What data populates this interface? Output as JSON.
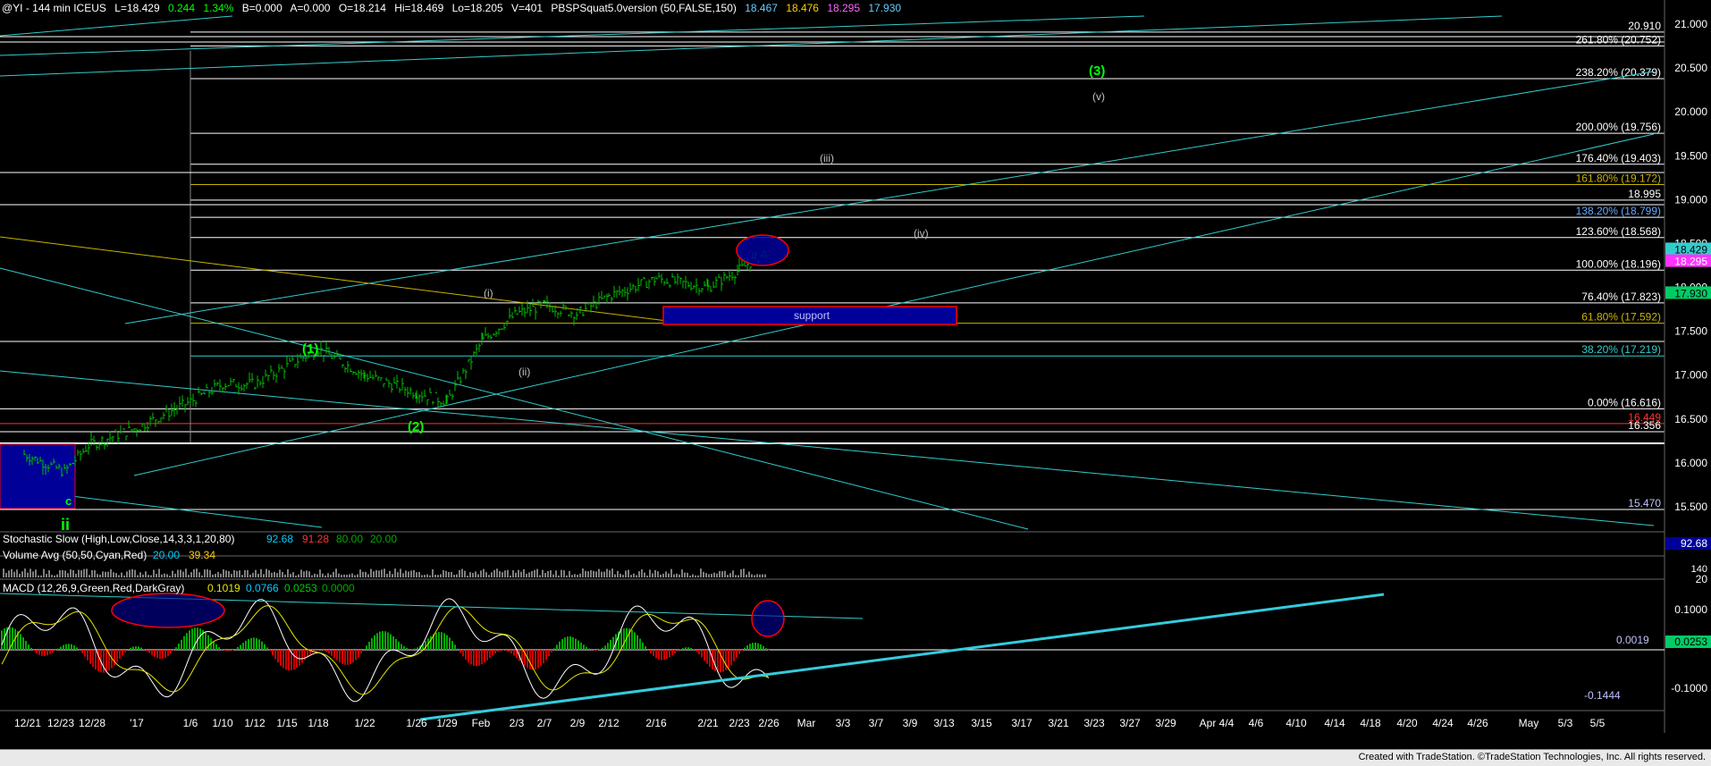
{
  "header": {
    "symbol": "@YI - 144 min ICEUS",
    "l": "L=18.429",
    "chg": "0.244",
    "pct": "1.34%",
    "b": "B=0.000",
    "a": "A=0.000",
    "o": "O=18.214",
    "hi": "Hi=18.469",
    "lo": "Lo=18.205",
    "v": "V=401",
    "study": "PBSPSquat5.0version (50,FALSE,150)",
    "s1": "18.467",
    "s2": "18.476",
    "s3": "18.295",
    "s4": "17.930"
  },
  "price_axis": {
    "ticks": [
      "21.000",
      "20.500",
      "20.000",
      "19.500",
      "19.000",
      "18.500",
      "18.000",
      "17.500",
      "17.000",
      "16.500",
      "16.000",
      "15.500"
    ],
    "last": "18.429",
    "mag": "18.295",
    "green": "17.930"
  },
  "fib_levels": [
    {
      "label": "20.910"
    },
    {
      "label": "261.80% (20.752)"
    },
    {
      "label": "238.20% (20.379)"
    },
    {
      "label": "200.00% (19.756)"
    },
    {
      "label": "176.40% (19.403)"
    },
    {
      "label": "161.80% (19.172)"
    },
    {
      "label": "18.995"
    },
    {
      "label": "138.20% (18.799)"
    },
    {
      "label": "123.60% (18.568)"
    },
    {
      "label": "100.00% (18.196)"
    },
    {
      "label": "76.40% (17.823)"
    },
    {
      "label": "61.80% (17.592)"
    },
    {
      "label": "38.20% (17.219)"
    },
    {
      "label": "0.00% (16.616)"
    },
    {
      "label": "16.449"
    },
    {
      "label": "16.356"
    },
    {
      "label": "15.470"
    }
  ],
  "wave_labels": {
    "w3": "(3)",
    "v": "(v)",
    "iii": "(iii)",
    "iv": "(iv)",
    "i": "(i)",
    "ii_paren": "(ii)",
    "w1": "(1)",
    "w2": "(2)",
    "c": "c",
    "ii": "ii",
    "support": "support"
  },
  "stochastic": {
    "label": "Stochastic Slow (High,Low,Close,14,3,3,1,20,80)",
    "v1": "92.68",
    "v2": "91.28",
    "v3": "80.00",
    "v4": "20.00",
    "axis": "92.68"
  },
  "volume": {
    "label": "Volume Avg (50,50,Cyan,Red)",
    "v1": "20.00",
    "v2": "39.34",
    "axis_top": "140",
    "axis_val": "20"
  },
  "macd": {
    "label": "MACD (12,26,9,Green,Red,DarkGray)",
    "v1": "0.1019",
    "v2": "0.0766",
    "v3": "0.0253",
    "v4": "0.0000",
    "axis": [
      "0.1000",
      "0.0253",
      "-0.1000"
    ],
    "zero_label": "0.0019",
    "low_label": "-0.1444"
  },
  "date_axis": [
    "12/21",
    "12/23",
    "12/28",
    "'17",
    "1/6",
    "1/10",
    "1/12",
    "1/15",
    "1/18",
    "1/22",
    "1/26",
    "1/29",
    "Feb",
    "2/3",
    "2/7",
    "2/9",
    "2/12",
    "2/16",
    "2/21",
    "2/23",
    "2/26",
    "Mar",
    "3/3",
    "3/7",
    "3/9",
    "3/13",
    "3/15",
    "3/17",
    "3/21",
    "3/23",
    "3/27",
    "3/29",
    "Apr 4/4",
    "4/6",
    "4/10",
    "4/14",
    "4/18",
    "4/20",
    "4/24",
    "4/26",
    "May",
    "5/3",
    "5/5"
  ],
  "footer": "Created with TradeStation. ©TradeStation Technologies, Inc. All rights reserved.",
  "colors": {
    "bars": "#00c000",
    "trend": "#33cccc",
    "support_box": "#000099",
    "support_border": "#ff0000",
    "wave_green": "#00ff00",
    "fib_gray": "#b0b0b0"
  },
  "chart_data": {
    "type": "line",
    "title": "@YI - 144 min ICEUS",
    "ylim": [
      15.2,
      21.2
    ],
    "series": [
      {
        "name": "@YI",
        "x": [
          "12/21",
          "12/23",
          "12/28",
          "'17",
          "1/6",
          "1/10",
          "1/12",
          "1/15",
          "1/18",
          "1/22",
          "1/26",
          "1/29",
          "Feb",
          "2/3",
          "2/7",
          "2/9",
          "2/12",
          "2/16",
          "2/21",
          "2/23",
          "2/26"
        ],
        "values": [
          16.1,
          15.9,
          16.2,
          16.4,
          16.7,
          16.9,
          16.9,
          17.1,
          17.3,
          17.0,
          16.8,
          16.7,
          17.4,
          17.7,
          17.8,
          17.7,
          17.9,
          18.1,
          18.0,
          18.2,
          18.43
        ]
      }
    ]
  }
}
